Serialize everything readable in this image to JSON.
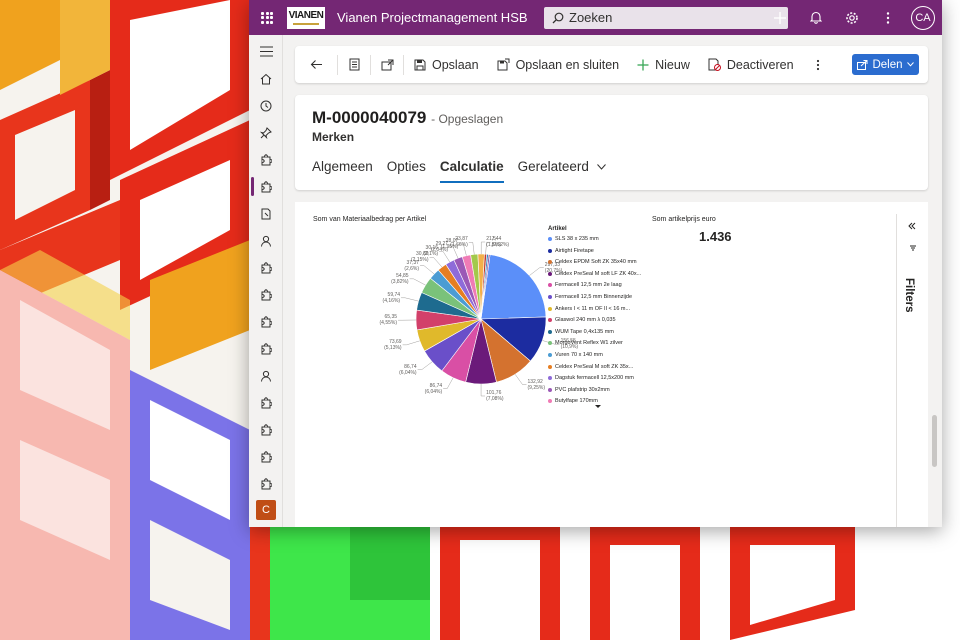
{
  "topbar": {
    "logo_text": "VIANEN",
    "app_title": "Vianen Projectmanagement HSB",
    "search_placeholder": "Zoeken",
    "avatar_initials": "CA"
  },
  "leftnav": {
    "bottom_badge": "C"
  },
  "commandbar": {
    "save": "Opslaan",
    "save_close": "Opslaan en sluiten",
    "new": "Nieuw",
    "deactivate": "Deactiveren",
    "share": "Delen"
  },
  "record": {
    "id": "M-0000040079",
    "status": "- Opgeslagen",
    "entity": "Merken",
    "tabs": [
      "Algemeen",
      "Opties",
      "Calculatie",
      "Gerelateerd"
    ],
    "active_tab": "Calculatie"
  },
  "report": {
    "filters_label": "Filters",
    "card_title": "Som artikelprijs euro",
    "card_value": "1.436"
  },
  "chart_data": {
    "type": "pie",
    "title": "Som van Materiaalbedrag per Artikel",
    "legend_title": "Artikel",
    "legend_position": "right",
    "slices": [
      {
        "label": "297,33 (20,7%)",
        "value": 297.33,
        "color": "#5b8ff9"
      },
      {
        "label": "156,55 (10,9%)",
        "value": 156.55,
        "color": "#1c2ca0"
      },
      {
        "label": "132,92 (9,25%)",
        "value": 132.92,
        "color": "#d4722f"
      },
      {
        "label": "101,76 (7,08%)",
        "value": 101.76,
        "color": "#6b1a7a"
      },
      {
        "label": "86,74 (6,04%)",
        "value": 86.74,
        "color": "#d94fa5"
      },
      {
        "label": "86,74 (6,04%)",
        "value": 86.74,
        "color": "#6a4fc9"
      },
      {
        "label": "73,69 (5,13%)",
        "value": 73.69,
        "color": "#e0b92b"
      },
      {
        "label": "65,35 (4,55%)",
        "value": 65.35,
        "color": "#d2406a"
      },
      {
        "label": "59,74 (4,16%)",
        "value": 59.74,
        "color": "#1e6b8f"
      },
      {
        "label": "54,85 (3,82%)",
        "value": 54.85,
        "color": "#7ac27a"
      },
      {
        "label": "37,37 (2,6%)",
        "value": 37.37,
        "color": "#4b9cd3"
      },
      {
        "label": "30,89 (2,15%)",
        "value": 30.89,
        "color": "#e67e22"
      },
      {
        "label": "30,16 (2,1%)",
        "value": 30.16,
        "color": "#8e6bd9"
      },
      {
        "label": "29,27 (2,04%)",
        "value": 29.27,
        "color": "#9b59b6"
      },
      {
        "label": "28,07 (1,95%)",
        "value": 28.07,
        "color": "#f07bb5"
      },
      {
        "label": "23,87 (1,66%)",
        "value": 23.87,
        "color": "#a3c94b"
      },
      {
        "label": "21,5 (1,5%)",
        "value": 21.5,
        "color": "#f2b04a"
      },
      {
        "label": "7,44 (0,52%)",
        "value": 7.44,
        "color": "#c0392b"
      },
      {
        "label": "",
        "value": 6.0,
        "color": "#2e86c1"
      },
      {
        "label": "",
        "value": 5.0,
        "color": "#7d3c98"
      }
    ],
    "legend": [
      {
        "name": "SLS 38 x 235 mm",
        "color": "#5b8ff9"
      },
      {
        "name": "Airtight Firetape",
        "color": "#1c2ca0"
      },
      {
        "name": "Celdex EPDM Soft ZK 35x40 mm",
        "color": "#d4722f"
      },
      {
        "name": "Celdex PreSeal M soft LF ZK 40x...",
        "color": "#6b1a7a"
      },
      {
        "name": "Fermacell 12,5 mm 2e laag",
        "color": "#d94fa5"
      },
      {
        "name": "Fermacell 12,5 mm Binnenzijde",
        "color": "#6a4fc9"
      },
      {
        "name": "Ankers I  <  11 m OF II  <  16 m...",
        "color": "#e0b92b"
      },
      {
        "name": "Glaswol 240 mm λ 0,035",
        "color": "#d2406a"
      },
      {
        "name": "WUM Tape 0,4x135 mm",
        "color": "#1e6b8f"
      },
      {
        "name": "MorgoVent Reflex W1 zilver",
        "color": "#7ac27a"
      },
      {
        "name": "Vuren 70 x 140 mm",
        "color": "#4b9cd3"
      },
      {
        "name": "Celdex PreSeal M soft ZK 35x...",
        "color": "#e67e22"
      },
      {
        "name": "Dagstuk fermacell 12,5x200 mm",
        "color": "#8e6bd9"
      },
      {
        "name": "PVC plafstrip 30x2mm",
        "color": "#9b59b6"
      },
      {
        "name": "Butylfape 170mm",
        "color": "#f07bb5"
      }
    ]
  }
}
